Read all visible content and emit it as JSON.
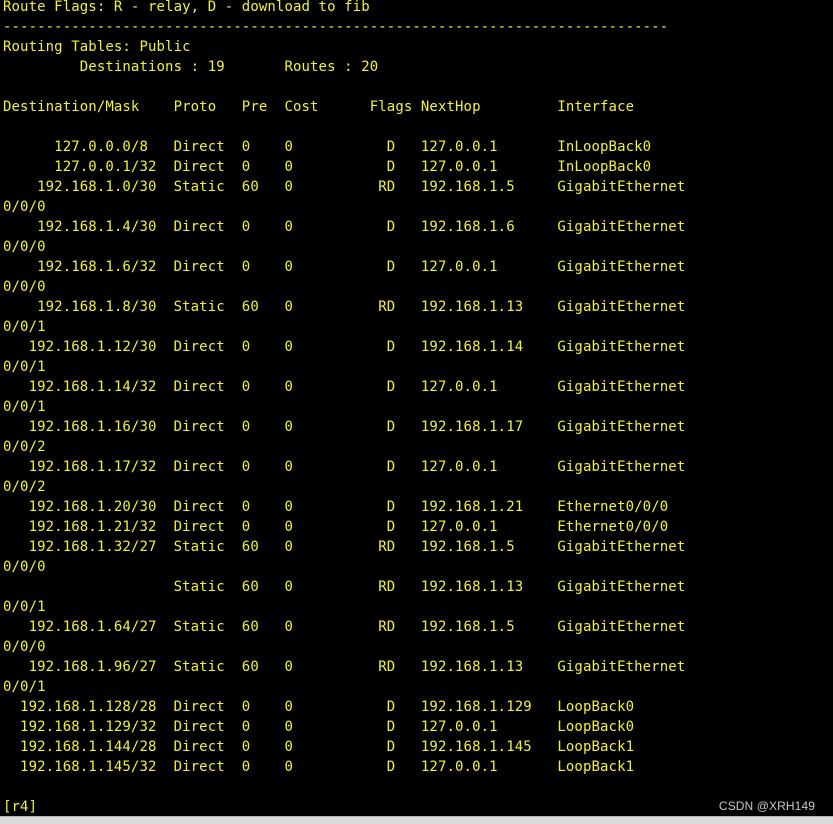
{
  "terminal": {
    "text_color": "#f2f23a",
    "background_color": "#000000",
    "lines": [
      "Route Flags: R - relay, D - download to fib",
      "------------------------------------------------------------------------------",
      "Routing Tables: Public",
      "         Destinations : 19       Routes : 20",
      "",
      "Destination/Mask    Proto   Pre  Cost      Flags NextHop         Interface",
      "",
      "      127.0.0.0/8   Direct  0    0           D   127.0.0.1       InLoopBack0",
      "      127.0.0.1/32  Direct  0    0           D   127.0.0.1       InLoopBack0",
      "    192.168.1.0/30  Static  60   0          RD   192.168.1.5     GigabitEthernet",
      "0/0/0",
      "    192.168.1.4/30  Direct  0    0           D   192.168.1.6     GigabitEthernet",
      "0/0/0",
      "    192.168.1.6/32  Direct  0    0           D   127.0.0.1       GigabitEthernet",
      "0/0/0",
      "    192.168.1.8/30  Static  60   0          RD   192.168.1.13    GigabitEthernet",
      "0/0/1",
      "   192.168.1.12/30  Direct  0    0           D   192.168.1.14    GigabitEthernet",
      "0/0/1",
      "   192.168.1.14/32  Direct  0    0           D   127.0.0.1       GigabitEthernet",
      "0/0/1",
      "   192.168.1.16/30  Direct  0    0           D   192.168.1.17    GigabitEthernet",
      "0/0/2",
      "   192.168.1.17/32  Direct  0    0           D   127.0.0.1       GigabitEthernet",
      "0/0/2",
      "   192.168.1.20/30  Direct  0    0           D   192.168.1.21    Ethernet0/0/0",
      "   192.168.1.21/32  Direct  0    0           D   127.0.0.1       Ethernet0/0/0",
      "   192.168.1.32/27  Static  60   0          RD   192.168.1.5     GigabitEthernet",
      "0/0/0",
      "                    Static  60   0          RD   192.168.1.13    GigabitEthernet",
      "0/0/1",
      "   192.168.1.64/27  Static  60   0          RD   192.168.1.5     GigabitEthernet",
      "0/0/0",
      "   192.168.1.96/27  Static  60   0          RD   192.168.1.13    GigabitEthernet",
      "0/0/1",
      "  192.168.1.128/28  Direct  0    0           D   192.168.1.129   LoopBack0",
      "  192.168.1.129/32  Direct  0    0           D   127.0.0.1       LoopBack0",
      "  192.168.1.144/28  Direct  0    0           D   192.168.1.145   LoopBack1",
      "  192.168.1.145/32  Direct  0    0           D   127.0.0.1       LoopBack1",
      "",
      "[r4]"
    ]
  },
  "watermark": "CSDN @XRH149"
}
